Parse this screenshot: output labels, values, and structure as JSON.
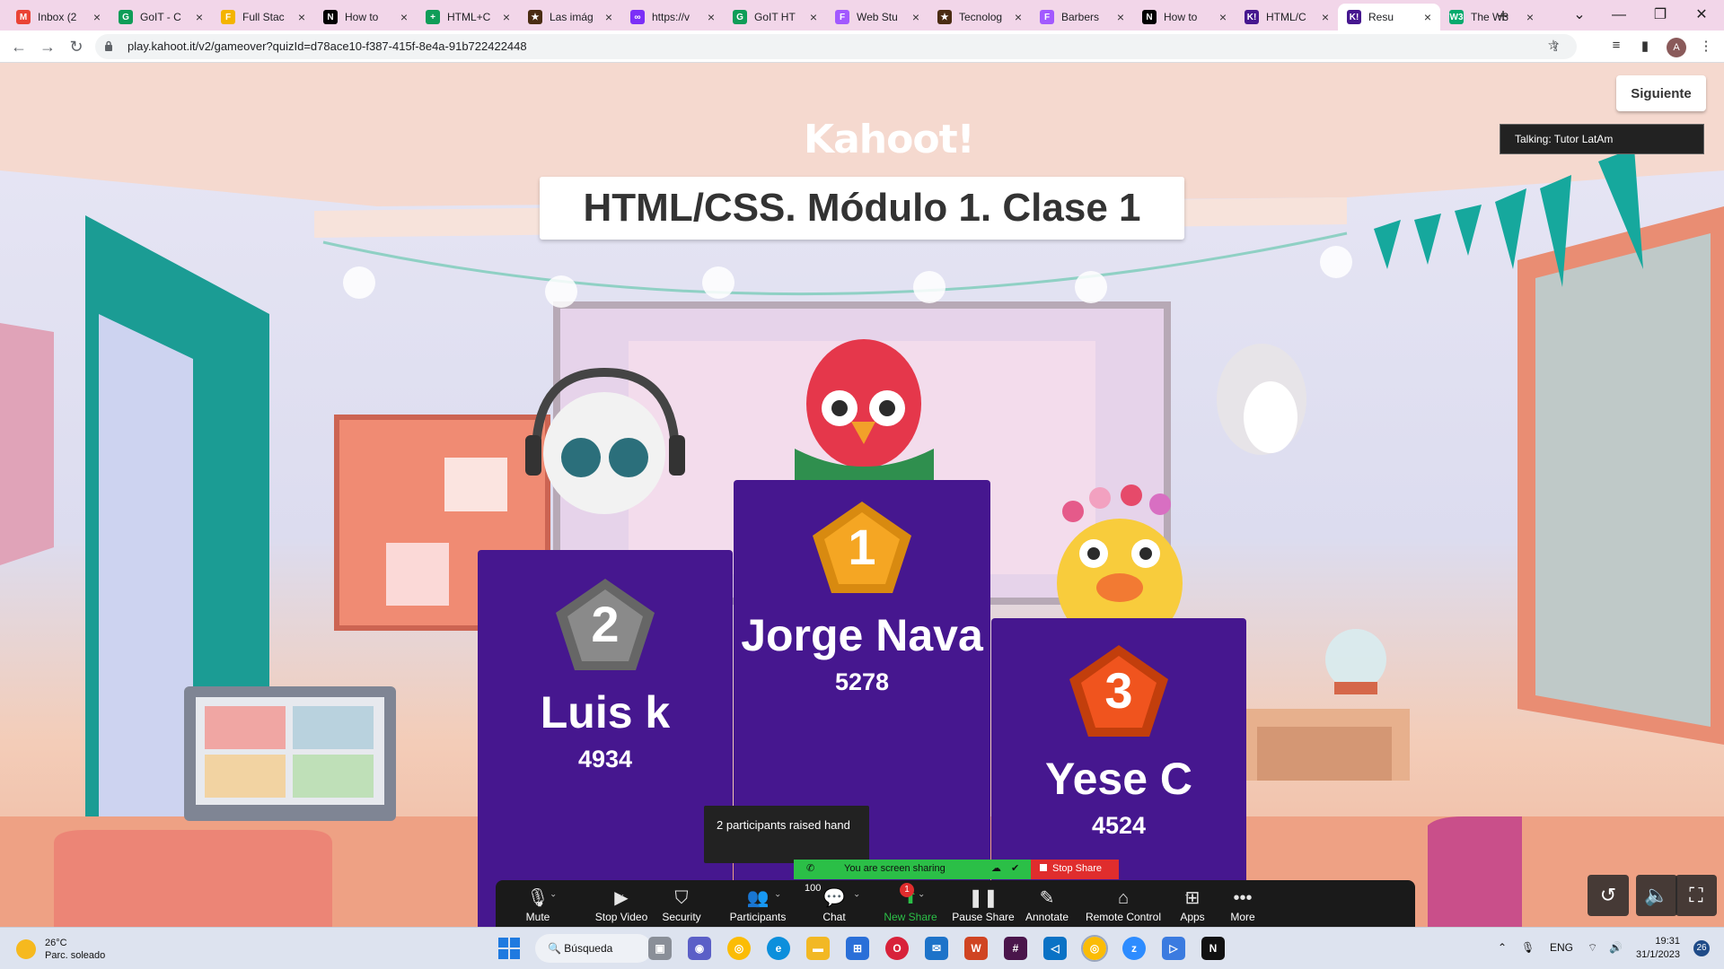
{
  "browser": {
    "tabs": [
      {
        "label": "Inbox (2",
        "icon": "gmail-icon",
        "color": "#ea4335",
        "glyph": "M"
      },
      {
        "label": "GoIT - C",
        "icon": "classroom-icon",
        "color": "#0f9d58",
        "glyph": "G"
      },
      {
        "label": "Full Stac",
        "icon": "slides-icon",
        "color": "#f4b400",
        "glyph": "F"
      },
      {
        "label": "How to",
        "icon": "notion-icon",
        "color": "#000000",
        "glyph": "N"
      },
      {
        "label": "HTML+C",
        "icon": "sheets-icon",
        "color": "#0f9d58",
        "glyph": "+"
      },
      {
        "label": "Las imág",
        "icon": "bookmark-star-icon",
        "color": "#4a2c12",
        "glyph": "★"
      },
      {
        "label": "https://v",
        "icon": "link-icon",
        "color": "#7b2ff7",
        "glyph": "∞"
      },
      {
        "label": "GoIT HT",
        "icon": "docs-icon",
        "color": "#0f9d58",
        "glyph": "G"
      },
      {
        "label": "Web Stu",
        "icon": "figma-icon",
        "color": "#a259ff",
        "glyph": "F"
      },
      {
        "label": "Tecnolog",
        "icon": "bookmark-star-icon",
        "color": "#4a2c12",
        "glyph": "★"
      },
      {
        "label": "Barbers",
        "icon": "figma-icon",
        "color": "#a259ff",
        "glyph": "F"
      },
      {
        "label": "How to",
        "icon": "notion-icon",
        "color": "#000000",
        "glyph": "N"
      },
      {
        "label": "HTML/C",
        "icon": "kahoot-icon",
        "color": "#46178f",
        "glyph": "K!"
      },
      {
        "label": "Resu",
        "icon": "kahoot-icon",
        "color": "#46178f",
        "glyph": "K!",
        "active": true
      },
      {
        "label": "The W3",
        "icon": "w3schools-icon",
        "color": "#04aa6d",
        "glyph": "W3"
      }
    ],
    "url": "play.kahoot.it/v2/gameover?quizId=d78ace10-f387-415f-8e4a-91b722422448",
    "profile_initial": "A"
  },
  "kahoot": {
    "logo": "Kahoot!",
    "quiz_title": "HTML/CSS. Módulo 1. Clase 1",
    "next_button": "Siguiente",
    "podium": [
      {
        "place": "1",
        "name": "Jorge Nava",
        "score": "5278",
        "medal_color": "#f5a623",
        "medal_dark": "#d88a10"
      },
      {
        "place": "2",
        "name": "Luis k",
        "score": "4934",
        "medal_color": "#8a8a8a",
        "medal_dark": "#666666"
      },
      {
        "place": "3",
        "name": "Yese C",
        "score": "4524",
        "medal_color": "#f0541e",
        "medal_dark": "#c23e0c"
      }
    ],
    "podium_color": "#46178f"
  },
  "zoom": {
    "talking": "Talking: Tutor LatAm",
    "raised_hands": "2 participants raised hand",
    "sharing_status": "You are screen sharing",
    "stop_share": "Stop Share",
    "participants_count": "100",
    "chat_badge": "1",
    "controls": [
      {
        "id": "mute",
        "label": "Mute",
        "icon": "microphone-icon",
        "glyph": "🎙"
      },
      {
        "id": "stop-video",
        "label": "Stop Video",
        "icon": "video-camera-icon",
        "glyph": "▶"
      },
      {
        "id": "security",
        "label": "Security",
        "icon": "shield-icon",
        "glyph": "⛉"
      },
      {
        "id": "participants",
        "label": "Participants",
        "icon": "people-icon",
        "glyph": "👥"
      },
      {
        "id": "chat",
        "label": "Chat",
        "icon": "chat-icon",
        "glyph": "💬"
      },
      {
        "id": "new-share",
        "label": "New Share",
        "icon": "share-arrow-icon",
        "glyph": "⬆"
      },
      {
        "id": "pause-share",
        "label": "Pause Share",
        "icon": "pause-icon",
        "glyph": "❚❚"
      },
      {
        "id": "annotate",
        "label": "Annotate",
        "icon": "pencil-icon",
        "glyph": "✎"
      },
      {
        "id": "remote-control",
        "label": "Remote Control",
        "icon": "mouse-icon",
        "glyph": "⌂"
      },
      {
        "id": "apps",
        "label": "Apps",
        "icon": "apps-icon",
        "glyph": "⊞"
      },
      {
        "id": "more",
        "label": "More",
        "icon": "ellipsis-icon",
        "glyph": "•••"
      }
    ]
  },
  "taskbar": {
    "weather_temp": "26°C",
    "weather_desc": "Parc. soleado",
    "search_label": "Búsqueda",
    "language": "ENG",
    "time": "19:31",
    "date": "31/1/2023",
    "notifications": "26"
  }
}
